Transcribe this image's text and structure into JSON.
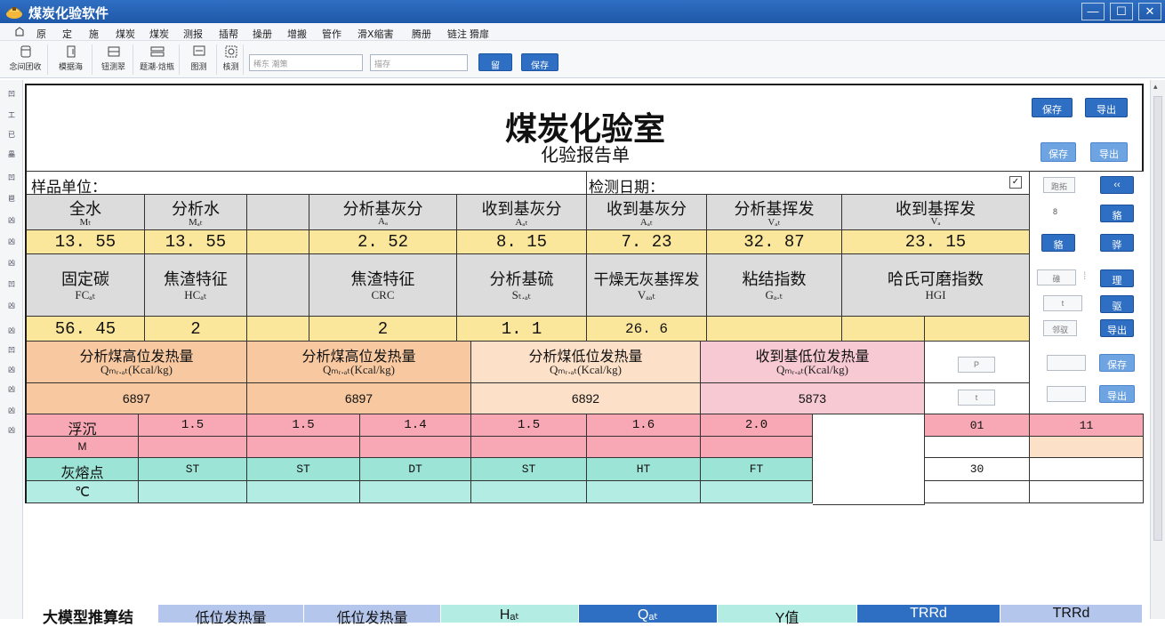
{
  "window": {
    "title": "煤炭化验软件",
    "min_glyph": "—",
    "max_glyph": "☐",
    "close_glyph": "✕"
  },
  "menu": [
    "原",
    "定",
    "施",
    "煤炭",
    "煤炭",
    "测报",
    "插帮",
    "操册",
    "增搬",
    "管作",
    "滑Ⅹ缩害",
    "腾册",
    "链注 猾扉"
  ],
  "toolbar": {
    "items": [
      "念间团收",
      "模据海",
      "钮测翠",
      "题潮·焓瓶",
      "图测",
      "核测"
    ],
    "search_placeholder": "稀东 潮策",
    "input2_placeholder": "描存",
    "btn1": "留",
    "btn2": "保存"
  },
  "left_icons": [
    "凹",
    "工",
    "已",
    "畾",
    "凹",
    "鬯",
    "凶",
    "凶",
    "凶",
    "凹",
    "凶",
    "凶",
    "凹",
    "凶",
    "凶"
  ],
  "report": {
    "title": "煤炭化验室",
    "subtitle": "化验报告单",
    "sample_unit_label": "样品单位：",
    "test_date_label": "检测日期：",
    "dropdown_glyph": "✓",
    "header1": [
      {
        "main": "全水",
        "sub": "Mₜ"
      },
      {
        "main": "分析水",
        "sub": "Mₐₜ"
      },
      {
        "main": "",
        "sub": ""
      },
      {
        "main": "分析基灰分",
        "sub": "Aₐ"
      },
      {
        "main": "收到基灰分",
        "sub": "Aₐₜ"
      },
      {
        "main": "收到基灰分",
        "sub": "Aₐₜ"
      },
      {
        "main": "分析基挥发",
        "sub": "Vₐₜ"
      },
      {
        "main": "收到基挥发",
        "sub": "Vₐ"
      }
    ],
    "values1": [
      "13. 55",
      "13. 55",
      "",
      "2. 52",
      "8. 15",
      "7. 23",
      "32. 87",
      "23. 15"
    ],
    "header2": [
      {
        "main": "固定碳",
        "sub": "FCₐₜ"
      },
      {
        "main": "焦渣特征",
        "sub": "HCₐₜ"
      },
      {
        "main": "",
        "sub": ""
      },
      {
        "main": "焦渣特征",
        "sub": "CRC"
      },
      {
        "main": "分析基硫",
        "sub": "Sₜ.ₐₜ"
      },
      {
        "main": "干燥无灰基挥发",
        "sub": "Vₐₐₜ"
      },
      {
        "main": "粘结指数",
        "sub": "Gₐ.ₜ"
      },
      {
        "main": "哈氏可磨指数",
        "sub": "HGI"
      }
    ],
    "values2": [
      "56. 45",
      "2",
      "",
      "2",
      "1. 1",
      "26. 6",
      "",
      "",
      ""
    ],
    "heat_headers": [
      {
        "main": "分析煤高位发热量",
        "sub": "Qₘᵣ.ₐₜ(Kcal/kg)"
      },
      {
        "main": "分析煤高位发热量",
        "sub": "Qₘᵣ.ₐₜ(Kcal/kg)"
      },
      {
        "main": "分析煤低位发热量",
        "sub": "Qₘᵣ.ₐₜ(Kcal/kg)"
      },
      {
        "main": "收到基低位发热量",
        "sub": "Qₘᵣ.ₐₜ(Kcal/kg)"
      }
    ],
    "heat_values": [
      "6897",
      "6897",
      "6892",
      "5873"
    ],
    "float_label": "浮沉",
    "float_values": [
      "1.5",
      "1.5",
      "1.4",
      "1.5",
      "1.6",
      "2.0"
    ],
    "float_right": [
      "01",
      "11"
    ],
    "m_label": "M",
    "ash_label": "灰熔点",
    "ash_values": [
      "ST",
      "ST",
      "DT",
      "ST",
      "HT",
      "FT"
    ],
    "ash_right": "30",
    "unit_label": "℃",
    "side_ghost_p": "P",
    "side_ghost_t": "t"
  },
  "right_panel": {
    "save_top": "保存",
    "export_top": "导出",
    "save2": "保存",
    "export2": "导出",
    "r1_ghost": "跑拓",
    "r1_btn": "‹‹",
    "r2_ghost": "8",
    "r2_btn": "貉",
    "r3_btn1": "貉",
    "r3_btn2": "骅",
    "r4_ghost": "碓",
    "r4_btn": "理",
    "r5_ghost": "t",
    "r5_btn": "驱",
    "r6_ghost": "邻驭",
    "r6_btn": "导出",
    "heat_save": "保存",
    "heat_export": "导出"
  },
  "bottom": {
    "label": "大模型推算结",
    "cells": [
      "低位发热量",
      "低位发热量",
      "Hₐₜ",
      "Qₐₜ",
      "Y值",
      "TRRd",
      "TRRd"
    ]
  },
  "colors": {
    "titlebar": "#1f58a8",
    "accent": "#2f6fc3",
    "yellow": "#fbe79b",
    "grey": "#dcdcdc",
    "orange": "#f8c9a0",
    "pink": "#f7a8b4",
    "teal": "#9be4d6"
  }
}
